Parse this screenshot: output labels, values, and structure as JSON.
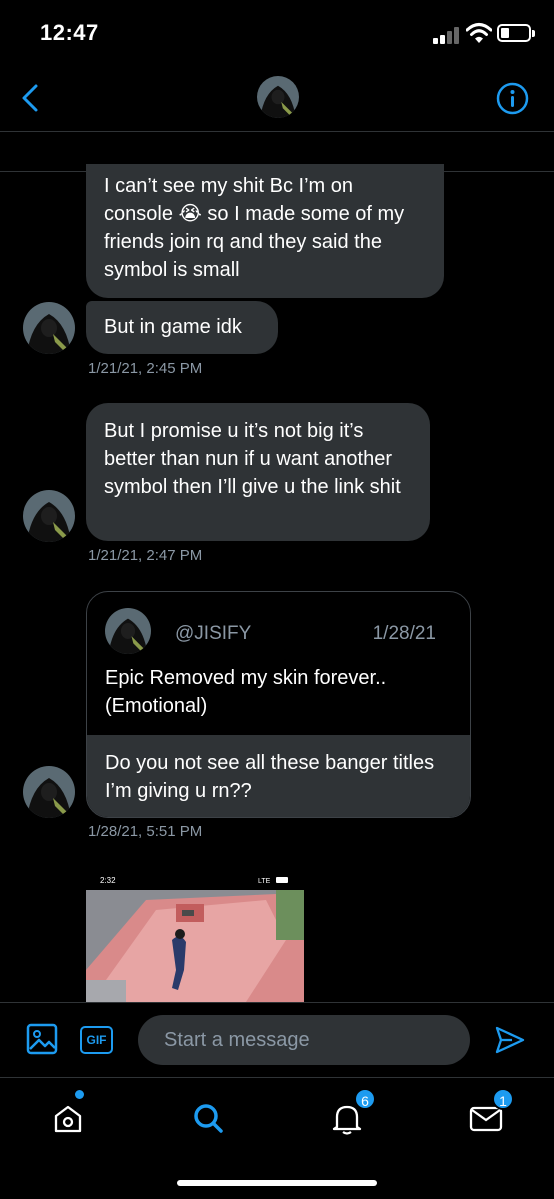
{
  "status_bar": {
    "time": "12:47"
  },
  "conversation": {
    "messages": [
      {
        "text": "I can’t see my shit Bc I’m on console 😭 so I made some of my friends join rq and they said the symbol is small"
      },
      {
        "text": "But in game idk",
        "timestamp": "1/21/21, 2:45 PM"
      },
      {
        "text": "But I promise u it’s not big it’s better than nun if u want another symbol then I’ll give u the link shit",
        "timestamp": "1/21/21, 2:47 PM"
      }
    ],
    "quote": {
      "handle": "@JISIFY",
      "date": "1/28/21",
      "text": "Epic Removed my skin forever.. (Emotional)",
      "reply": "Do you not see all these banger titles I’m giving u rn??",
      "timestamp": "1/28/21, 5:51 PM"
    },
    "media": {
      "time": "2:32",
      "network": "LTE"
    }
  },
  "composer": {
    "gif_label": "GIF",
    "placeholder": "Start a message"
  },
  "tab_bar": {
    "notifications_badge": "6",
    "messages_badge": "1"
  },
  "colors": {
    "accent": "#1d9bf0",
    "bubble": "#2f3336",
    "muted": "#8b98a5"
  }
}
